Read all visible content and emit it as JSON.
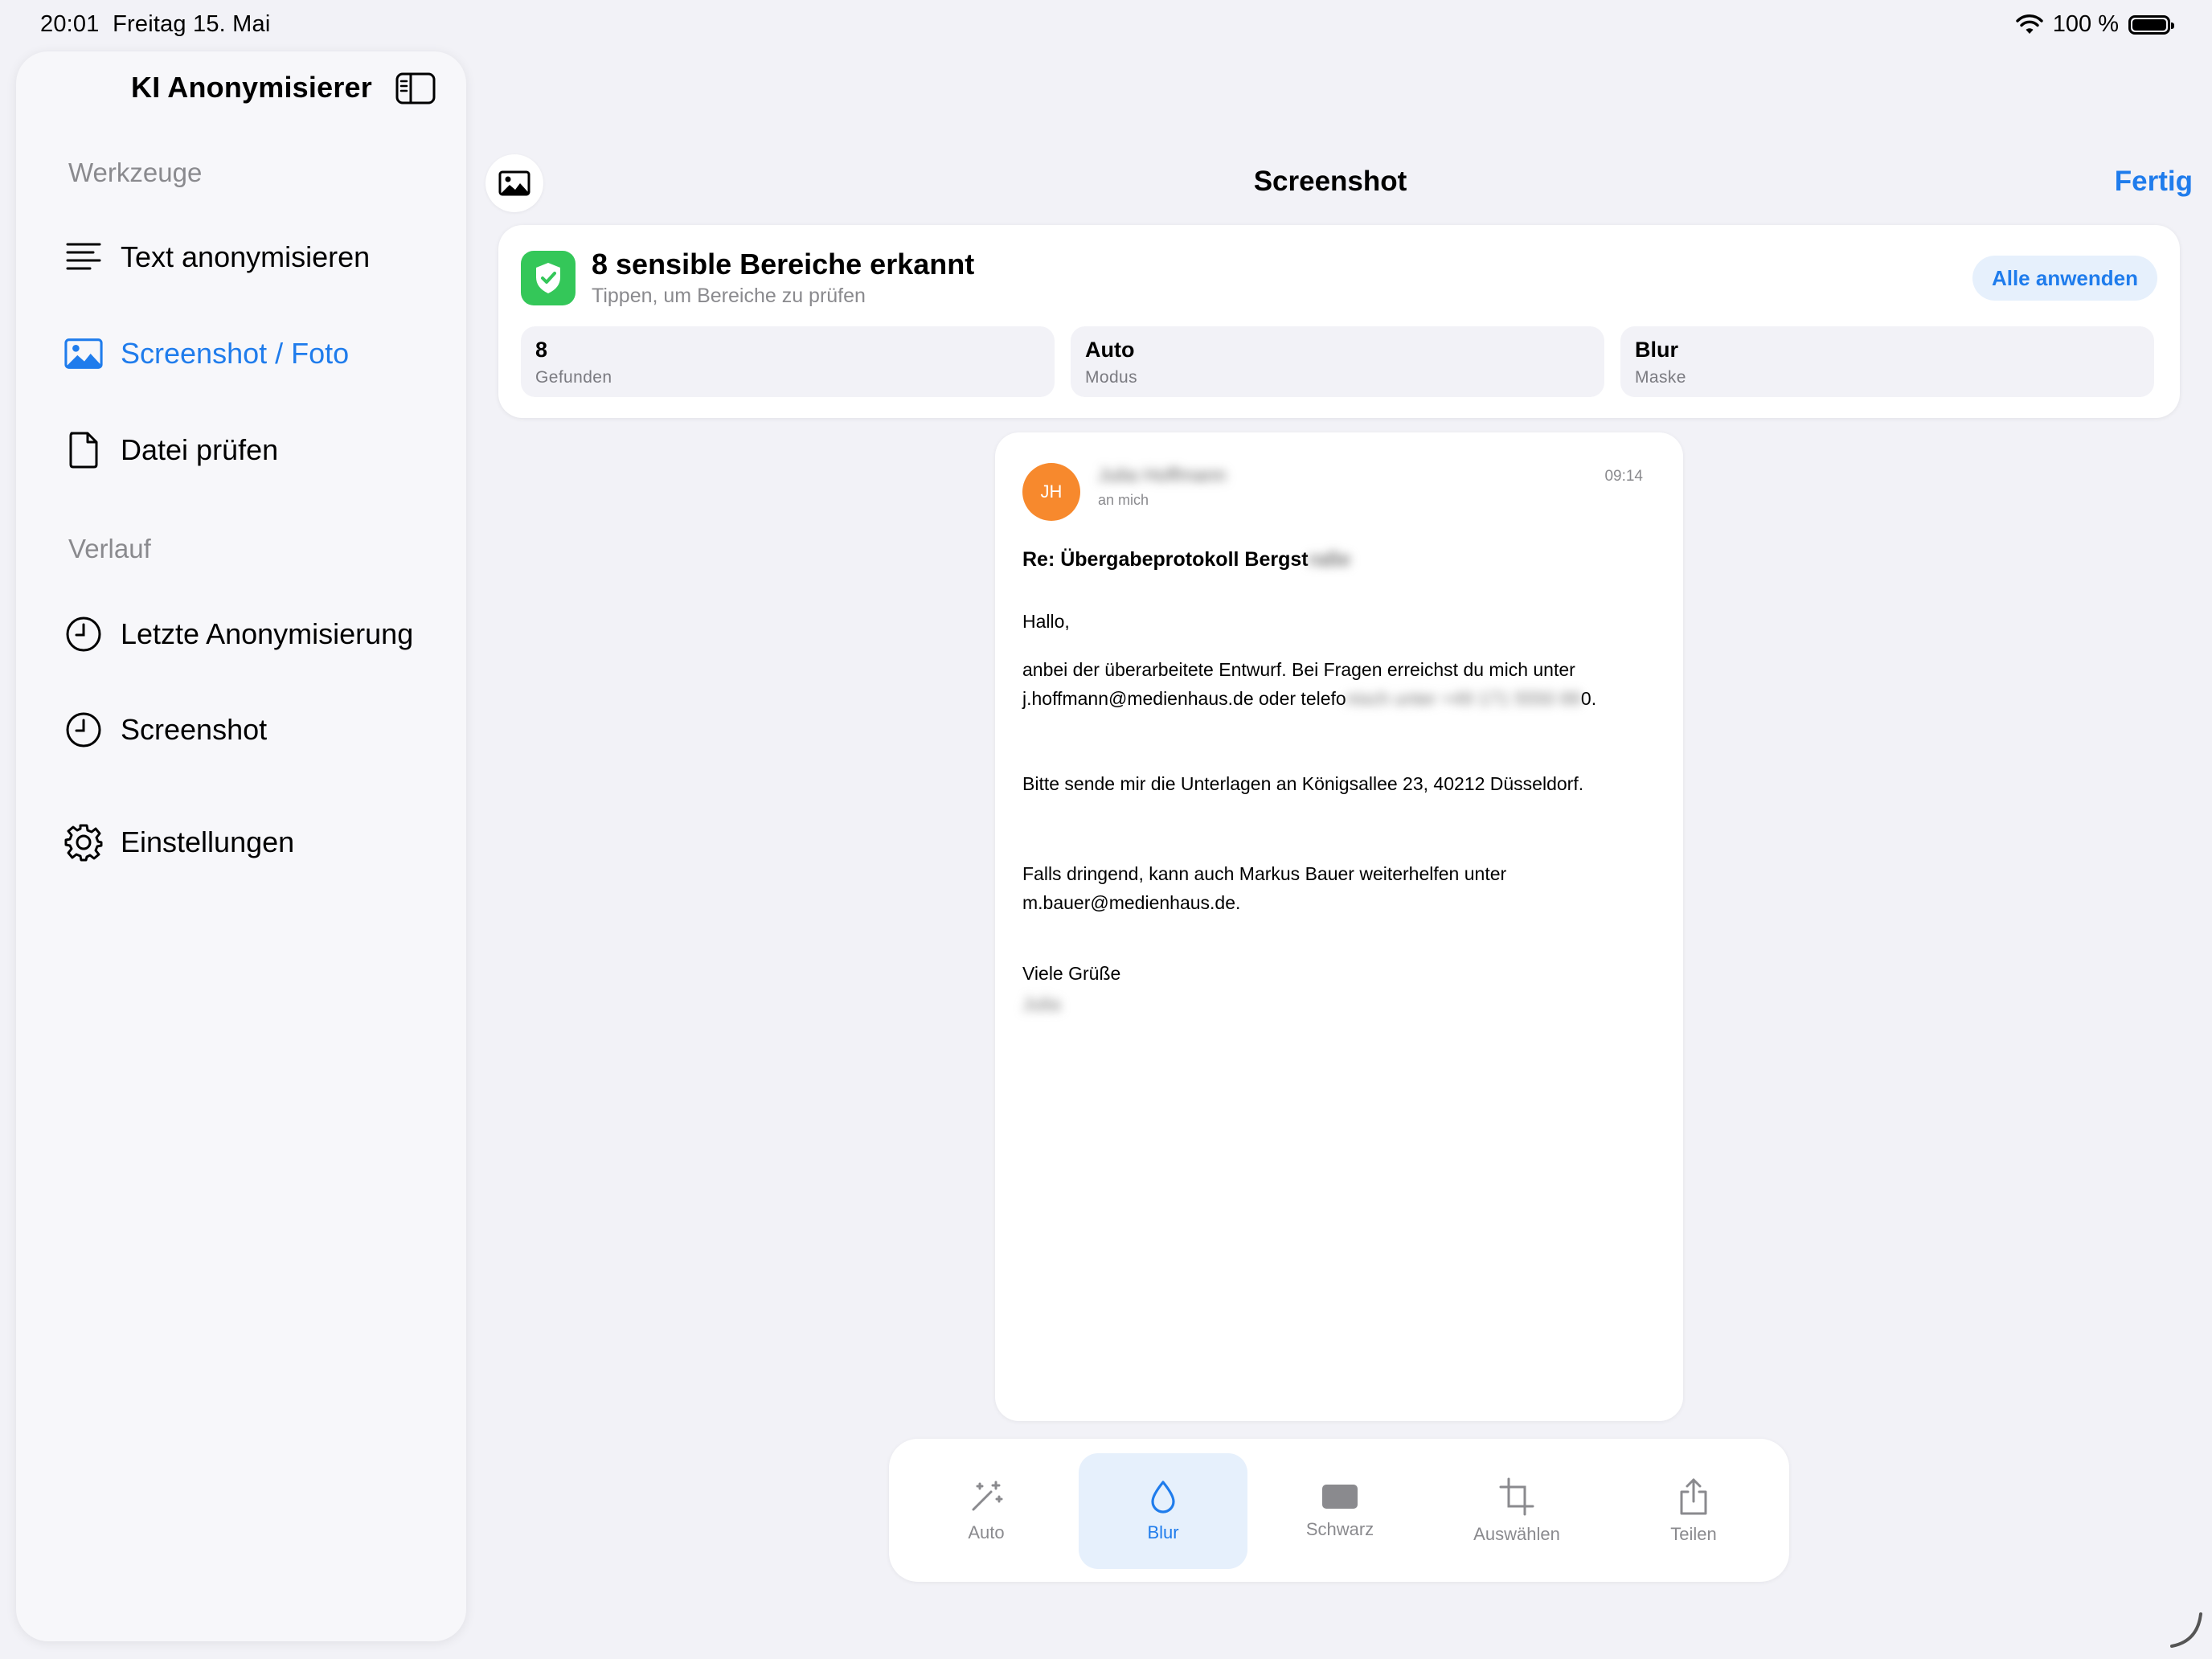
{
  "status_bar": {
    "time": "20:01",
    "date": "Freitag 15. Mai",
    "battery": "100 %"
  },
  "sidebar": {
    "title": "KI Anonymisierer",
    "sections": [
      {
        "label": "Werkzeuge"
      },
      {
        "label": "Verlauf"
      }
    ],
    "items": [
      {
        "label": "Text anonymisieren",
        "icon": "text-lines-icon"
      },
      {
        "label": "Screenshot / Foto",
        "icon": "photo-icon",
        "active": true
      },
      {
        "label": "Datei prüfen",
        "icon": "document-icon"
      },
      {
        "label": "Letzte Anonymisierung",
        "icon": "clock-icon"
      },
      {
        "label": "Screenshot",
        "icon": "clock-icon"
      },
      {
        "label": "Einstellungen",
        "icon": "gear-icon"
      }
    ]
  },
  "header": {
    "title": "Screenshot",
    "done_label": "Fertig"
  },
  "summary": {
    "title": "8 sensible Bereiche erkannt",
    "subtitle": "Tippen, um Bereiche zu prüfen",
    "apply_all_label": "Alle anwenden",
    "stats": [
      {
        "value": "8",
        "label": "Gefunden"
      },
      {
        "value": "Auto",
        "label": "Modus"
      },
      {
        "value": "Blur",
        "label": "Maske"
      }
    ],
    "accent": "#34c759"
  },
  "email": {
    "avatar_initials": "JH",
    "sender": "Julia Hoffmann",
    "recipient": "an mich",
    "time": "09:14",
    "subject_visible": "Re: Übergabeprotokoll Bergst",
    "subject_blurred": "raße",
    "greeting": "Hallo,",
    "body_line1": "anbei der überarbeitete Entwurf. Bei Fragen erreichst du mich unter",
    "body_line2_visible": "j.hoffmann@medienhaus.de oder telefo",
    "body_line2_blurred": "nisch unter +49 171 5550 89",
    "body_line2_end": "0.",
    "body_line3": "Bitte sende mir die Unterlagen an Königsallee 23, 40212 Düsseldorf.",
    "body_line4": "Falls dringend, kann auch Markus Bauer weiterhelfen unter",
    "body_line5": "m.bauer@medienhaus.de.",
    "closing": "Viele Grüße",
    "signature_blurred": "Julia"
  },
  "toolbar": {
    "tools": [
      {
        "label": "Auto",
        "icon": "magic-wand-icon"
      },
      {
        "label": "Blur",
        "icon": "drop-icon",
        "active": true
      },
      {
        "label": "Schwarz",
        "icon": "black-rect-icon"
      },
      {
        "label": "Auswählen",
        "icon": "crop-icon"
      },
      {
        "label": "Teilen",
        "icon": "share-icon"
      }
    ]
  },
  "colors": {
    "accent_blue": "#1f7cec",
    "avatar_orange": "#f7892d",
    "background": "#f2f2f7"
  }
}
